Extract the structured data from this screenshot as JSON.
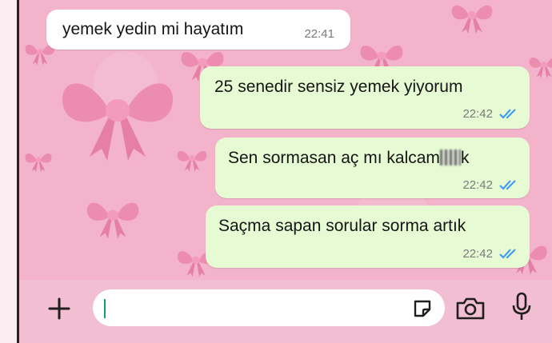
{
  "messages": [
    {
      "direction": "incoming",
      "text": "yemek yedin mi hayatım",
      "time": "22:41"
    },
    {
      "direction": "outgoing",
      "text": "25 senedir sensiz yemek yiyorum",
      "time": "22:42",
      "status": "read"
    },
    {
      "direction": "outgoing",
      "text": "Sen sormasan aç mı kalcam",
      "redacted_suffix": "k",
      "time": "22:42",
      "status": "read"
    },
    {
      "direction": "outgoing",
      "text": "Saçma sapan sorular sorma artık",
      "time": "22:42",
      "status": "read"
    }
  ],
  "composer": {
    "placeholder": "",
    "attach_icon": "plus-icon",
    "sticker_icon": "sticker-icon",
    "camera_icon": "camera-icon",
    "mic_icon": "microphone-icon"
  },
  "colors": {
    "wallpaper": "#f3b3ca",
    "incoming_bubble": "#ffffff",
    "outgoing_bubble": "#e6fbd4",
    "read_ticks": "#3497f9",
    "bow": "#ee8fb0"
  }
}
